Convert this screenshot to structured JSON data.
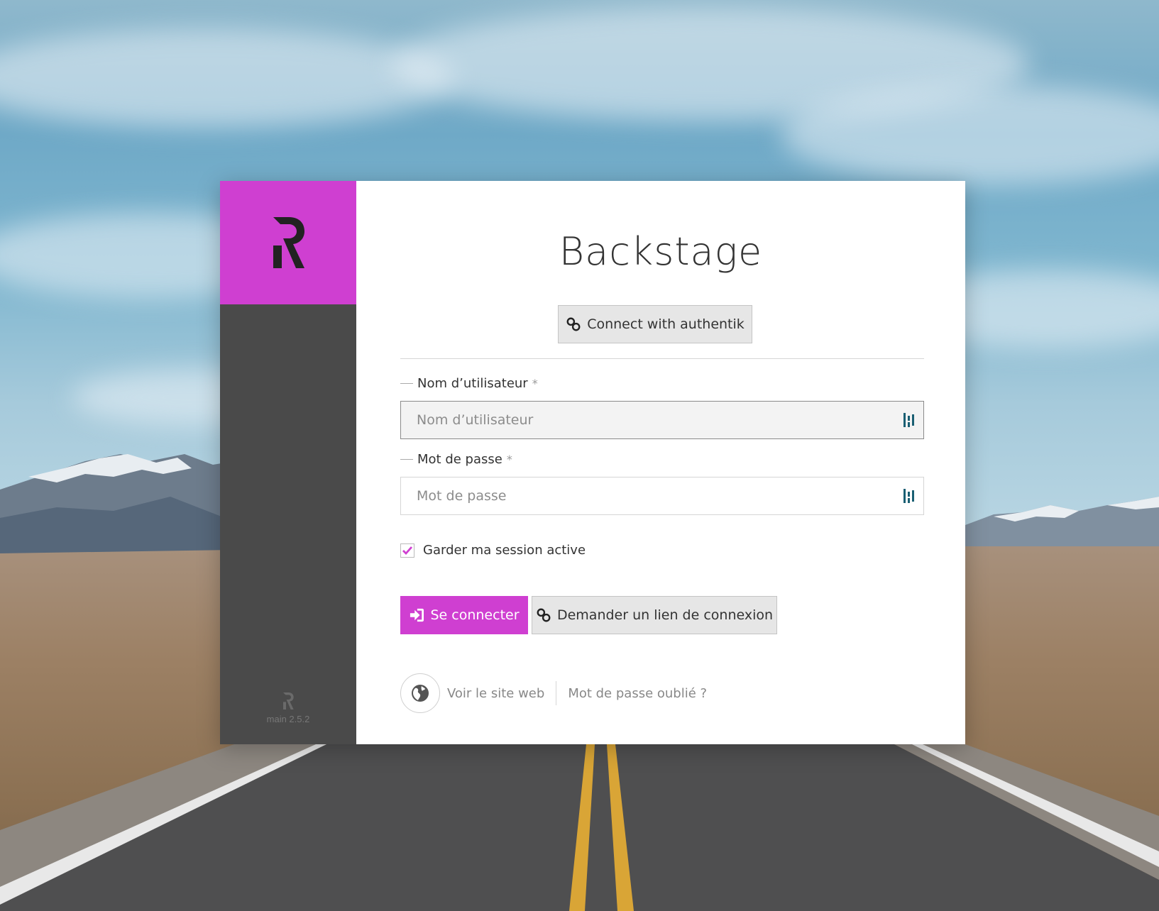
{
  "app": {
    "title": "Backstage",
    "version": "main 2.5.2"
  },
  "colors": {
    "brand": "#cf3fd1",
    "sidebar": "#4a4a4a",
    "icon_teal": "#1a5f73"
  },
  "sso": {
    "label": "Connect with authentik",
    "icon": "link-icon"
  },
  "form": {
    "username": {
      "label": "Nom d’utilisateur",
      "required_mark": "*",
      "placeholder": "Nom d’utilisateur",
      "value": ""
    },
    "password": {
      "label": "Mot de passe",
      "required_mark": "*",
      "placeholder": "Mot de passe",
      "value": ""
    },
    "remember": {
      "label": "Garder ma session active",
      "checked": true
    },
    "submit_label": "Se connecter",
    "submit_icon": "sign-in-icon",
    "magic_link_label": "Demander un lien de connexion",
    "magic_link_icon": "link-icon"
  },
  "footer": {
    "website_label": "Voir le site web",
    "website_icon": "globe-icon",
    "forgot_label": "Mot de passe oublié ?"
  }
}
